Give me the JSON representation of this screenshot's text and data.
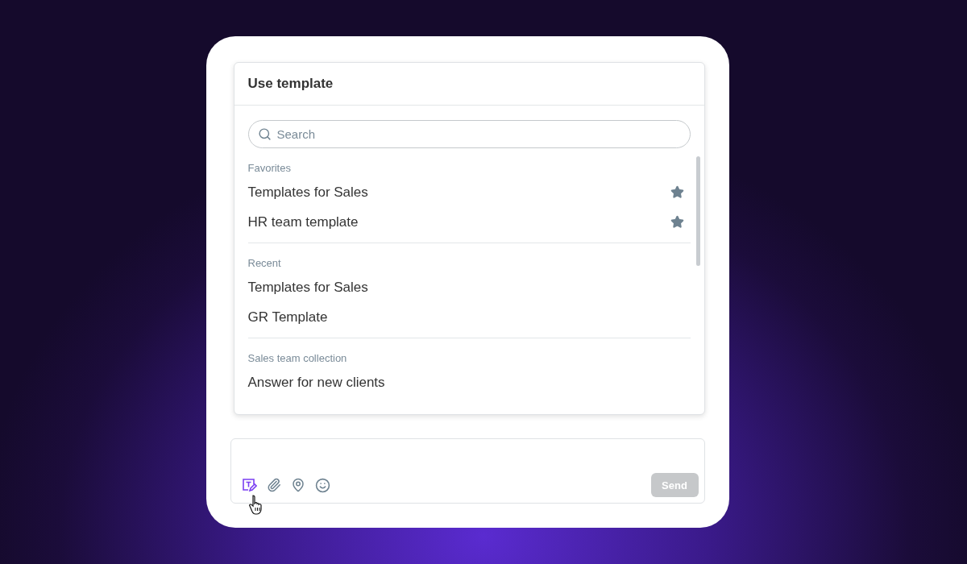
{
  "popup": {
    "title": "Use template",
    "search": {
      "placeholder": "Search"
    },
    "sections": [
      {
        "title": "Favorites",
        "items": [
          {
            "label": "Templates for Sales",
            "starred": true
          },
          {
            "label": "HR team template",
            "starred": true
          }
        ]
      },
      {
        "title": "Recent",
        "items": [
          {
            "label": "Templates for Sales",
            "starred": false
          },
          {
            "label": "GR Template",
            "starred": false
          }
        ]
      },
      {
        "title": "Sales team collection",
        "items": [
          {
            "label": "Answer for new clients",
            "starred": false
          }
        ]
      }
    ]
  },
  "composer": {
    "tools": [
      {
        "kind": "template",
        "active": true
      },
      {
        "kind": "attach",
        "active": false
      },
      {
        "kind": "location",
        "active": false
      },
      {
        "kind": "emoji",
        "active": false
      }
    ],
    "send": {
      "label": "Send",
      "disabled": true
    }
  }
}
